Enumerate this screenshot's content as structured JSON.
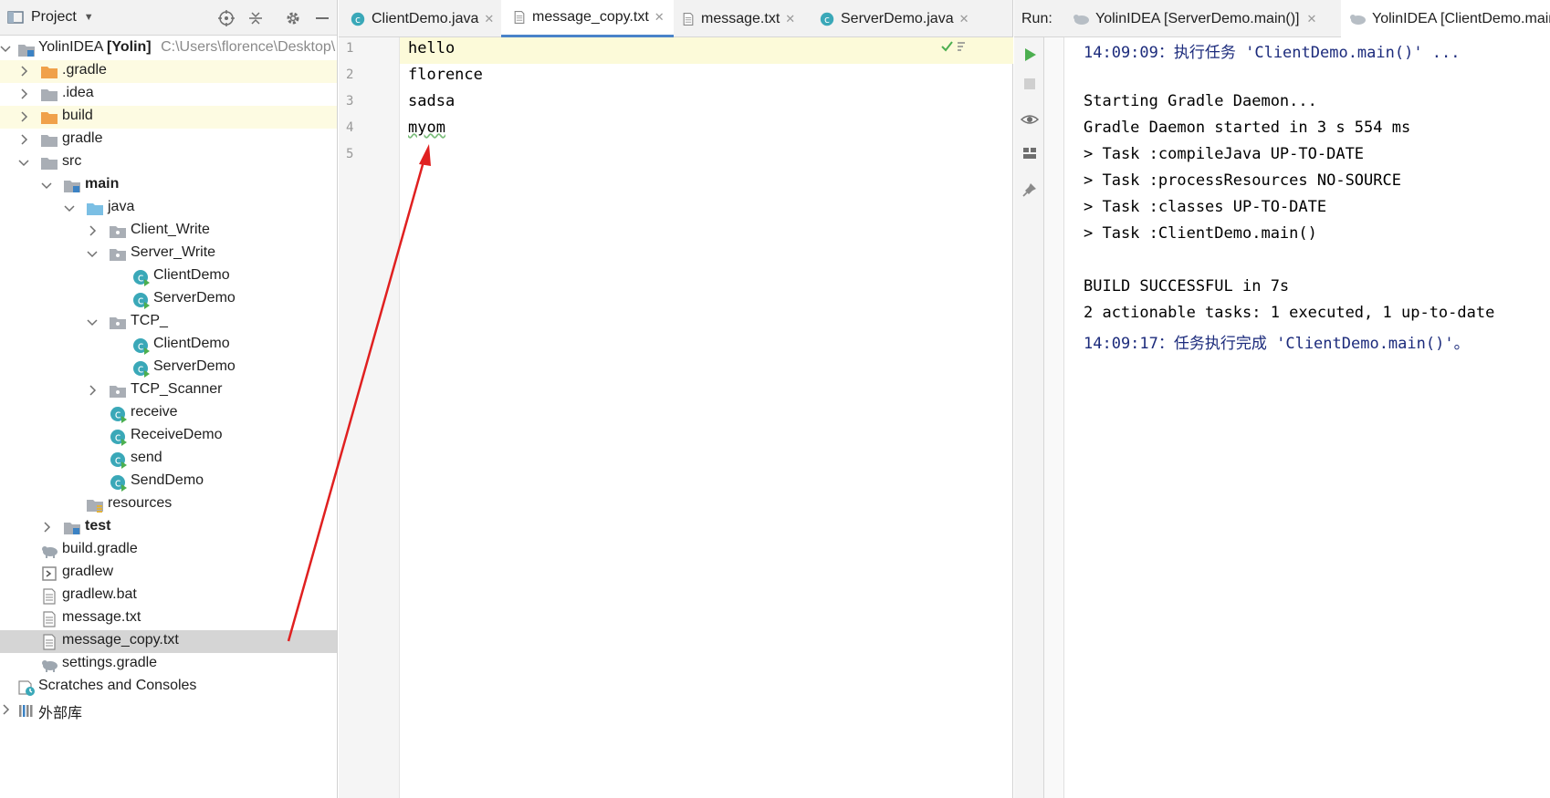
{
  "project": {
    "title": "Project",
    "tree": [
      {
        "label": "YolinIDEA",
        "extra": "[Yolin]",
        "path": "C:\\Users\\florence\\Desktop\\"
      },
      {
        "label": ".gradle"
      },
      {
        "label": ".idea"
      },
      {
        "label": "build"
      },
      {
        "label": "gradle"
      },
      {
        "label": "src"
      },
      {
        "label": "main"
      },
      {
        "label": "java"
      },
      {
        "label": "Client_Write"
      },
      {
        "label": "Server_Write"
      },
      {
        "label": "ClientDemo"
      },
      {
        "label": "ServerDemo"
      },
      {
        "label": "TCP_"
      },
      {
        "label": "ClientDemo"
      },
      {
        "label": "ServerDemo"
      },
      {
        "label": "TCP_Scanner"
      },
      {
        "label": "receive"
      },
      {
        "label": "ReceiveDemo"
      },
      {
        "label": "send"
      },
      {
        "label": "SendDemo"
      },
      {
        "label": "resources"
      },
      {
        "label": "test"
      },
      {
        "label": "build.gradle"
      },
      {
        "label": "gradlew"
      },
      {
        "label": "gradlew.bat"
      },
      {
        "label": "message.txt"
      },
      {
        "label": "message_copy.txt"
      },
      {
        "label": "settings.gradle"
      },
      {
        "label": "Scratches and Consoles"
      },
      {
        "label": "外部库"
      }
    ]
  },
  "editor": {
    "tabs": [
      {
        "label": "ClientDemo.java"
      },
      {
        "label": "message_copy.txt"
      },
      {
        "label": "message.txt"
      },
      {
        "label": "ServerDemo.java"
      }
    ],
    "line_numbers": [
      "1",
      "2",
      "3",
      "4",
      "5"
    ],
    "lines": [
      "hello",
      "florence",
      "sadsa",
      "myom",
      ""
    ]
  },
  "run": {
    "label": "Run:",
    "tabs": [
      {
        "label": "YolinIDEA [ServerDemo.main()]"
      },
      {
        "label": "YolinIDEA [ClientDemo.main()]"
      }
    ],
    "console": [
      "14:09:09：执行任务  'ClientDemo.main()' ...",
      "",
      "Starting Gradle Daemon...",
      "Gradle Daemon started in 3 s 554 ms",
      "> Task :compileJava UP-TO-DATE",
      "> Task :processResources NO-SOURCE",
      "> Task :classes UP-TO-DATE",
      "> Task :ClientDemo.main()",
      "",
      "BUILD SUCCESSFUL in 7s",
      "2 actionable tasks: 1 executed, 1 up-to-date",
      "14:09:17：任务执行完成  'ClientDemo.main()'。"
    ]
  },
  "colors": {
    "folder_orange": "#f0a14a",
    "folder_gray": "#a9aeb5",
    "folder_blue": "#7bbfe4",
    "class_teal": "#3aa8b8",
    "run_green": "#4caf50",
    "console_blue": "#1c2b7c",
    "annotation_red": "#e02020",
    "active_tab_underline": "#4a83c9"
  }
}
